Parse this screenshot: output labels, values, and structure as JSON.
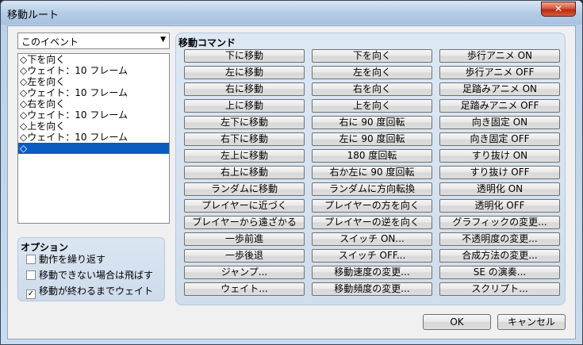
{
  "window": {
    "title": "移動ルート",
    "close_icon": "close-icon",
    "close_glyph": "✕"
  },
  "target": {
    "selected": "このイベント",
    "arrow": "▼"
  },
  "route": {
    "items": [
      "◇下を向く",
      "◇ウェイト：10 フレーム",
      "◇左を向く",
      "◇ウェイト：10 フレーム",
      "◇右を向く",
      "◇ウェイト：10 フレーム",
      "◇上を向く",
      "◇ウェイト：10 フレーム",
      "◇"
    ],
    "selected_index": 8
  },
  "options": {
    "title": "オプション",
    "repeat": {
      "label": "動作を繰り返す",
      "checked": false
    },
    "skip": {
      "label": "移動できない場合は飛ばす",
      "checked": false
    },
    "wait": {
      "label": "移動が終わるまでウェイト",
      "checked": true
    },
    "check_glyph": "✓"
  },
  "commands": {
    "title": "移動コマンド",
    "rows": [
      [
        "下に移動",
        "下を向く",
        "歩行アニメ ON"
      ],
      [
        "左に移動",
        "左を向く",
        "歩行アニメ OFF"
      ],
      [
        "右に移動",
        "右を向く",
        "足踏みアニメ ON"
      ],
      [
        "上に移動",
        "上を向く",
        "足踏みアニメ OFF"
      ],
      [
        "左下に移動",
        "右に 90 度回転",
        "向き固定 ON"
      ],
      [
        "右下に移動",
        "左に 90 度回転",
        "向き固定 OFF"
      ],
      [
        "左上に移動",
        "180 度回転",
        "すり抜け ON"
      ],
      [
        "右上に移動",
        "右か左に 90 度回転",
        "すり抜け OFF"
      ],
      [
        "ランダムに移動",
        "ランダムに方向転換",
        "透明化 ON"
      ],
      [
        "プレイヤーに近づく",
        "プレイヤーの方を向く",
        "透明化 OFF"
      ],
      [
        "プレイヤーから遠ざかる",
        "プレイヤーの逆を向く",
        "グラフィックの変更..."
      ],
      [
        "一歩前進",
        "スイッチ ON...",
        "不透明度の変更..."
      ],
      [
        "一歩後退",
        "スイッチ OFF...",
        "合成方法の変更..."
      ],
      [
        "ジャンプ...",
        "移動速度の変更...",
        "SE の演奏..."
      ],
      [
        "ウェイト...",
        "移動頻度の変更...",
        "スクリプト..."
      ]
    ]
  },
  "buttons": {
    "ok": "OK",
    "cancel": "キャンセル"
  }
}
